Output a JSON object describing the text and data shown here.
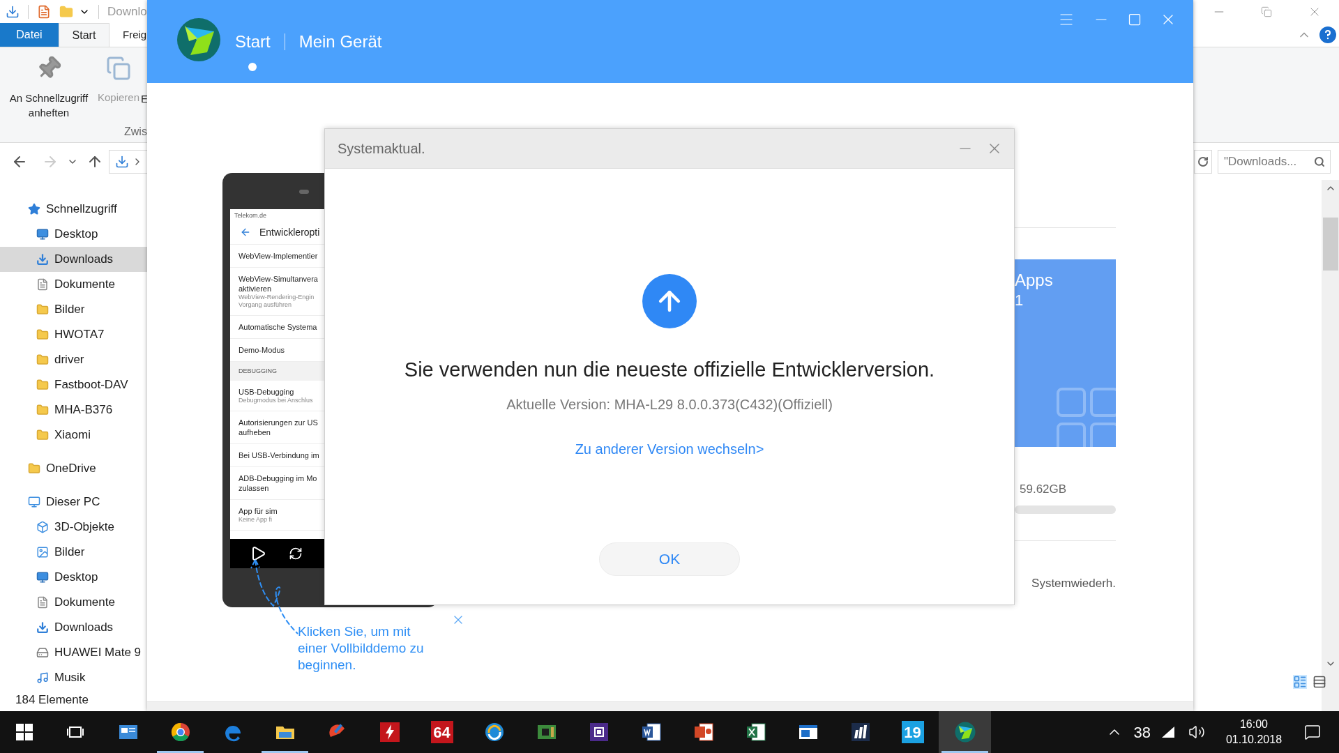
{
  "explorer": {
    "title": "Downlo",
    "ribbon_tabs": [
      {
        "label": "Datei",
        "kind": "menu",
        "selected": false
      },
      {
        "label": "Start",
        "kind": "tab",
        "selected": true
      },
      {
        "label": "Freig",
        "kind": "tab",
        "selected": false
      }
    ],
    "ribbon_buttons": [
      {
        "label": "An Schnellzugriff anheften",
        "disabled": false
      },
      {
        "label": "Kopieren",
        "disabled": true
      },
      {
        "label": "E",
        "disabled": false
      }
    ],
    "group_label": "Zwis",
    "search": {
      "placeholder": "\"Downloads..."
    },
    "sidebar": [
      {
        "label": "Schnellzugriff",
        "kind": "star",
        "selected": false,
        "children": [
          {
            "label": "Desktop",
            "kind": "desktop",
            "selected": false
          },
          {
            "label": "Downloads",
            "kind": "download",
            "selected": true
          },
          {
            "label": "Dokumente",
            "kind": "document",
            "selected": false
          },
          {
            "label": "Bilder",
            "kind": "folder",
            "selected": false
          },
          {
            "label": "HWOTA7",
            "kind": "folder",
            "selected": false
          },
          {
            "label": "driver",
            "kind": "folder",
            "selected": false
          },
          {
            "label": "Fastboot-DAV",
            "kind": "folder",
            "selected": false
          },
          {
            "label": "MHA-B376",
            "kind": "folder",
            "selected": false
          },
          {
            "label": "Xiaomi",
            "kind": "folder",
            "selected": false
          }
        ]
      },
      {
        "label": "OneDrive",
        "kind": "folder",
        "selected": false
      },
      {
        "label": "Dieser PC",
        "kind": "pc",
        "selected": false,
        "children": [
          {
            "label": "3D-Objekte",
            "kind": "cube",
            "selected": false
          },
          {
            "label": "Bilder",
            "kind": "pictures",
            "selected": false
          },
          {
            "label": "Desktop",
            "kind": "desktop",
            "selected": false
          },
          {
            "label": "Dokumente",
            "kind": "document",
            "selected": false
          },
          {
            "label": "Downloads",
            "kind": "download",
            "selected": false
          },
          {
            "label": "HUAWEI Mate 9",
            "kind": "drive",
            "selected": false
          },
          {
            "label": "Musik",
            "kind": "music",
            "selected": false
          }
        ]
      }
    ],
    "status": "184 Elemente"
  },
  "hisuite": {
    "nav": [
      {
        "label": "Start",
        "selected": true
      },
      {
        "label": "Mein Gerät",
        "selected": false
      }
    ],
    "phone": {
      "carrier": "Telekom.de",
      "title": "Entwickleropti",
      "rows": [
        {
          "kind": "item",
          "title": "WebView-Implementier"
        },
        {
          "kind": "item",
          "title": "WebView-Simultanvera\naktivieren",
          "subtitle": "WebView-Rendering-Engin\nVorgang ausführen"
        },
        {
          "kind": "item",
          "title": "Automatische Systema"
        },
        {
          "kind": "item",
          "title": "Demo-Modus"
        },
        {
          "kind": "section",
          "title": "DEBUGGING"
        },
        {
          "kind": "item",
          "title": "USB-Debugging",
          "subtitle": "Debugmodus bei Anschlus"
        },
        {
          "kind": "item",
          "title": "Autorisierungen zur US\naufheben"
        },
        {
          "kind": "item",
          "title": "Bei USB-Verbindung im"
        },
        {
          "kind": "item",
          "title": "ADB-Debugging im Mo\nzulassen"
        },
        {
          "kind": "item",
          "title": "App für sim",
          "subtitle": "Keine App fi"
        }
      ]
    },
    "device": {
      "card_title": "Apps",
      "card_value": "1",
      "storage": "59.62GB",
      "action": "Systemwiederh."
    },
    "callout": "Klicken Sie, um mit einer Vollbilddemo zu beginnen."
  },
  "dialog": {
    "title": "Systemaktual.",
    "heading": "Sie verwenden nun die neueste offizielle Entwicklerversion.",
    "version": "Aktuelle Version: MHA-L29 8.0.0.373(C432)(Offiziell)",
    "link": "Zu anderer Version wechseln>",
    "ok": "OK"
  },
  "taskbar": {
    "items": [
      {
        "kind": "panel",
        "running": false,
        "selected": false
      },
      {
        "kind": "rings",
        "running": true,
        "selected": false
      },
      {
        "kind": "swoosh",
        "running": false,
        "selected": false
      },
      {
        "kind": "folder",
        "running": true,
        "selected": false
      },
      {
        "kind": "brush",
        "running": false,
        "selected": false
      },
      {
        "kind": "bolt",
        "running": false,
        "selected": false
      },
      {
        "kind": "tile",
        "text": "64",
        "color": "#c4161c",
        "running": false,
        "selected": false
      },
      {
        "kind": "sync",
        "running": false,
        "selected": false
      },
      {
        "kind": "board",
        "running": false,
        "selected": false
      },
      {
        "kind": "chip",
        "running": false,
        "selected": false
      },
      {
        "kind": "doc",
        "running": false,
        "selected": false
      },
      {
        "kind": "slides",
        "running": false,
        "selected": false
      },
      {
        "kind": "sheet",
        "running": false,
        "selected": false
      },
      {
        "kind": "window",
        "running": false,
        "selected": false
      },
      {
        "kind": "chart",
        "running": false,
        "selected": false
      },
      {
        "kind": "tile",
        "text": "19",
        "color": "#1ba1e2",
        "running": false,
        "selected": false
      },
      {
        "kind": "logo",
        "running": true,
        "selected": true
      }
    ],
    "temperature": "38",
    "time": "16:00",
    "date": "01.10.2018"
  }
}
